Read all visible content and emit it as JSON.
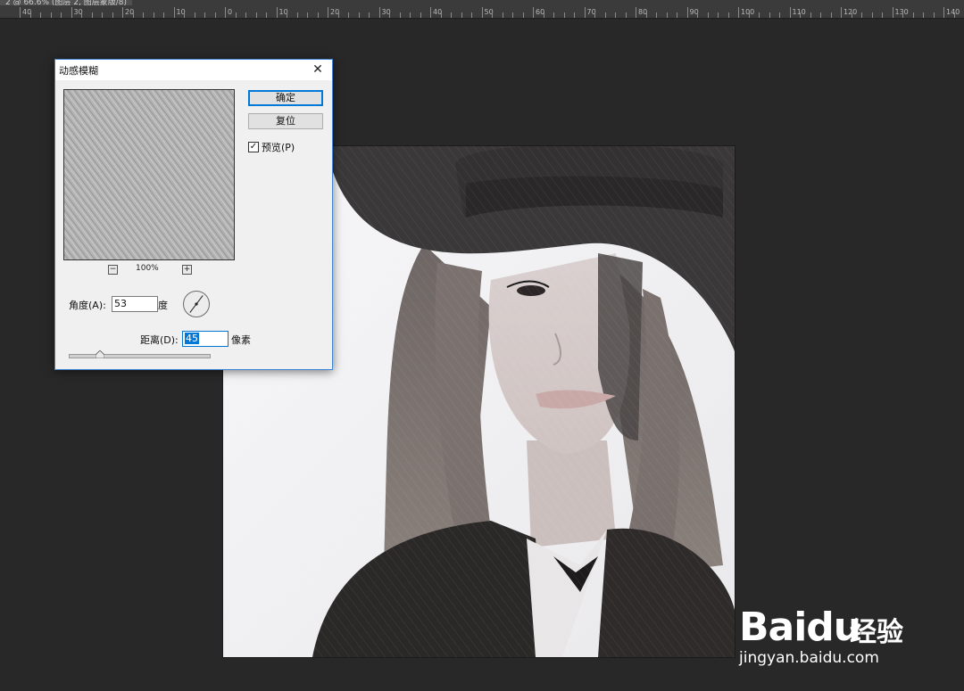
{
  "document_tab": {
    "label": "2 @ 66.6% (图层 2, 图层蒙版/8)"
  },
  "ruler": {
    "labels": [
      "40",
      "30",
      "20",
      "10",
      "0",
      "10",
      "20",
      "30",
      "40",
      "50",
      "60",
      "70",
      "80",
      "90",
      "100",
      "110",
      "120",
      "130",
      "140"
    ]
  },
  "dialog": {
    "title": "动感模糊",
    "close_glyph": "✕",
    "ok_label": "确定",
    "reset_label": "复位",
    "preview_checkbox": {
      "label": "预览(P)",
      "checked": true,
      "check_glyph": "✓"
    },
    "zoom": {
      "minus": "−",
      "plus": "+",
      "level": "100%"
    },
    "angle": {
      "label": "角度(A):",
      "value": "53",
      "unit": "度"
    },
    "distance": {
      "label": "距离(D):",
      "value": "45",
      "unit": "像素"
    },
    "distance_slider": {
      "value": 45,
      "max": 200
    }
  },
  "watermark": {
    "brand": "Baidu",
    "brand_cn": "经验",
    "url": "jingyan.baidu.com"
  },
  "colors": {
    "workspace": "#282828",
    "accent": "#0078d7"
  }
}
